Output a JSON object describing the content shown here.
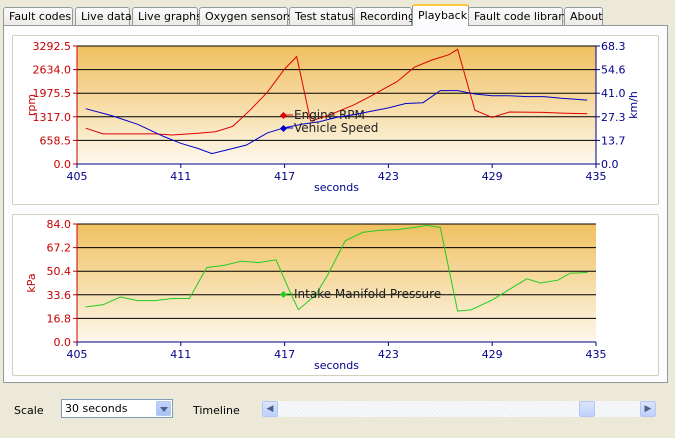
{
  "tabs": [
    {
      "label": "Fault codes"
    },
    {
      "label": "Live data"
    },
    {
      "label": "Live graphs"
    },
    {
      "label": "Oxygen sensors"
    },
    {
      "label": "Test status"
    },
    {
      "label": "Recording"
    },
    {
      "label": "Playback",
      "active": true
    },
    {
      "label": "Fault code library"
    },
    {
      "label": "About"
    }
  ],
  "bottom": {
    "scale_label": "Scale",
    "scale_value": "30 seconds",
    "timeline_label": "Timeline",
    "timeline_position": 0.87
  },
  "chart_data": [
    {
      "type": "line",
      "xlabel": "seconds",
      "ylabel": "rpm",
      "y2label": "km/h",
      "xlim": [
        405,
        435
      ],
      "ylim": [
        0,
        3292.5
      ],
      "y2lim": [
        0,
        68.3
      ],
      "x_ticks": [
        "405",
        "411",
        "417",
        "423",
        "429",
        "435"
      ],
      "y_ticks": [
        "0.0",
        "658.5",
        "1317.0",
        "1975.5",
        "2634.0",
        "3292.5"
      ],
      "y2_ticks": [
        "0.0",
        "13.7",
        "27.3",
        "41.0",
        "54.6",
        "68.3"
      ],
      "series": [
        {
          "name": "Engine RPM",
          "axis": "left",
          "color": "#e00000",
          "points": [
            [
              405.5,
              1000
            ],
            [
              406.5,
              840
            ],
            [
              408,
              840
            ],
            [
              409.5,
              840
            ],
            [
              410.5,
              810
            ],
            [
              412,
              860
            ],
            [
              413,
              900
            ],
            [
              414,
              1050
            ],
            [
              415,
              1500
            ],
            [
              416,
              2000
            ],
            [
              417,
              2650
            ],
            [
              417.7,
              3000
            ],
            [
              418.5,
              1200
            ],
            [
              419.5,
              1350
            ],
            [
              421,
              1650
            ],
            [
              422,
              1900
            ],
            [
              423.5,
              2300
            ],
            [
              424.5,
              2700
            ],
            [
              425.5,
              2900
            ],
            [
              426.5,
              3050
            ],
            [
              427,
              3200
            ],
            [
              428,
              1500
            ],
            [
              429,
              1300
            ],
            [
              430,
              1450
            ],
            [
              432,
              1440
            ],
            [
              433,
              1420
            ],
            [
              434.5,
              1400
            ]
          ]
        },
        {
          "name": "Vehicle Speed",
          "axis": "right",
          "color": "#0000cc",
          "points": [
            [
              405.5,
              32
            ],
            [
              407,
              28
            ],
            [
              408.5,
              23
            ],
            [
              410,
              16
            ],
            [
              411,
              12
            ],
            [
              412,
              9
            ],
            [
              412.8,
              6
            ],
            [
              414,
              9
            ],
            [
              414.8,
              11
            ],
            [
              416,
              18
            ],
            [
              417,
              21
            ],
            [
              418,
              23
            ],
            [
              419,
              24.5
            ],
            [
              420,
              27
            ],
            [
              421,
              28.5
            ],
            [
              422,
              30.5
            ],
            [
              423,
              32.5
            ],
            [
              424,
              35
            ],
            [
              425,
              35.5
            ],
            [
              426,
              42.5
            ],
            [
              427,
              42.5
            ],
            [
              428,
              40.5
            ],
            [
              429,
              39.5
            ],
            [
              430,
              39.5
            ],
            [
              431,
              39
            ],
            [
              432,
              39
            ],
            [
              433,
              38
            ],
            [
              434.5,
              37
            ]
          ]
        }
      ]
    },
    {
      "type": "line",
      "xlabel": "seconds",
      "ylabel": "kPa",
      "xlim": [
        405,
        435
      ],
      "ylim": [
        0,
        84.0
      ],
      "x_ticks": [
        "405",
        "411",
        "417",
        "423",
        "429",
        "435"
      ],
      "y_ticks": [
        "0.0",
        "16.8",
        "33.6",
        "50.4",
        "67.2",
        "84.0"
      ],
      "series": [
        {
          "name": "Intake Manifold Pressure",
          "axis": "left",
          "color": "#22cc22",
          "points": [
            [
              405.5,
              25
            ],
            [
              406.5,
              26.5
            ],
            [
              407.5,
              32
            ],
            [
              408.5,
              29.5
            ],
            [
              409.5,
              29.5
            ],
            [
              410.5,
              31
            ],
            [
              411.5,
              31
            ],
            [
              412.5,
              53
            ],
            [
              413.5,
              54.5
            ],
            [
              414.5,
              57.5
            ],
            [
              415.5,
              56.5
            ],
            [
              416.5,
              58.5
            ],
            [
              417.3,
              36
            ],
            [
              417.8,
              23
            ],
            [
              418.8,
              33.5
            ],
            [
              419.5,
              48
            ],
            [
              420.5,
              72
            ],
            [
              421.5,
              78
            ],
            [
              422.5,
              79.5
            ],
            [
              423.5,
              80
            ],
            [
              424.5,
              81.5
            ],
            [
              425.2,
              83
            ],
            [
              426,
              81.5
            ],
            [
              427,
              22
            ],
            [
              427.8,
              23
            ],
            [
              429,
              30
            ],
            [
              430,
              37.5
            ],
            [
              431,
              45
            ],
            [
              431.8,
              42
            ],
            [
              432.8,
              44
            ],
            [
              433.5,
              49
            ],
            [
              434.5,
              49.5
            ]
          ]
        }
      ]
    }
  ]
}
